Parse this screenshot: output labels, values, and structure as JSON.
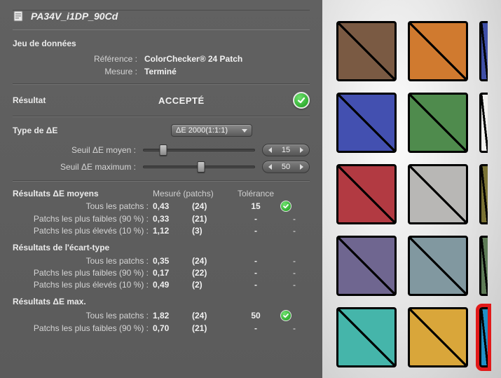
{
  "title": "PA34V_i1DP_90Cd",
  "dataset": {
    "heading": "Jeu de données",
    "reference_label": "Référence :",
    "reference_value": "ColorChecker® 24 Patch",
    "measure_label": "Mesure :",
    "measure_value": "Terminé"
  },
  "result": {
    "label": "Résultat",
    "value": "ACCEPTÉ",
    "status": "pass"
  },
  "de_type": {
    "label": "Type de ΔE",
    "selected": "ΔE 2000(1:1:1)",
    "threshold_avg_label": "Seuil ΔE moyen :",
    "threshold_avg_value": "15",
    "threshold_max_label": "Seuil ΔE maximum :",
    "threshold_max_value": "50"
  },
  "columns": {
    "measured": "Mesuré (patchs)",
    "tolerance": "Tolérance"
  },
  "avg": {
    "heading": "Résultats ΔE moyens",
    "rows": [
      {
        "label": "Tous les patchs :",
        "measured": "0,43",
        "count": "(24)",
        "tol": "15",
        "status": "pass"
      },
      {
        "label": "Patchs les plus faibles (90 %) :",
        "measured": "0,33",
        "count": "(21)",
        "tol": "-",
        "status": "-"
      },
      {
        "label": "Patchs les plus élevés (10 %) :",
        "measured": "1,12",
        "count": "(3)",
        "tol": "-",
        "status": "-"
      }
    ]
  },
  "std": {
    "heading": "Résultats de l'écart-type",
    "rows": [
      {
        "label": "Tous les patchs :",
        "measured": "0,35",
        "count": "(24)",
        "tol": "-",
        "status": "-"
      },
      {
        "label": "Patchs les plus faibles (90 %) :",
        "measured": "0,17",
        "count": "(22)",
        "tol": "-",
        "status": "-"
      },
      {
        "label": "Patchs les plus élevés (10 %) :",
        "measured": "0,49",
        "count": "(2)",
        "tol": "-",
        "status": "-"
      }
    ]
  },
  "max": {
    "heading": "Résultats ΔE max.",
    "rows": [
      {
        "label": "Tous les patchs :",
        "measured": "1,82",
        "count": "(24)",
        "tol": "50",
        "status": "pass"
      },
      {
        "label": "Patchs les plus faibles (90 %) :",
        "measured": "0,70",
        "count": "(21)",
        "tol": "-",
        "status": "-"
      }
    ]
  },
  "swatches": [
    [
      "#7a5a43",
      "#d07a2f",
      "#3f4fa6"
    ],
    [
      "#4350b0",
      "#4f8b4d",
      "#f2f1ef"
    ],
    [
      "#b23a42",
      "#b8b7b5",
      "#797235"
    ],
    [
      "#6f6690",
      "#8198a0",
      "#5e7b57"
    ],
    [
      "#45b5aa",
      "#d9a63a",
      "#1f8fc6"
    ]
  ],
  "selected_swatch": [
    4,
    2
  ]
}
